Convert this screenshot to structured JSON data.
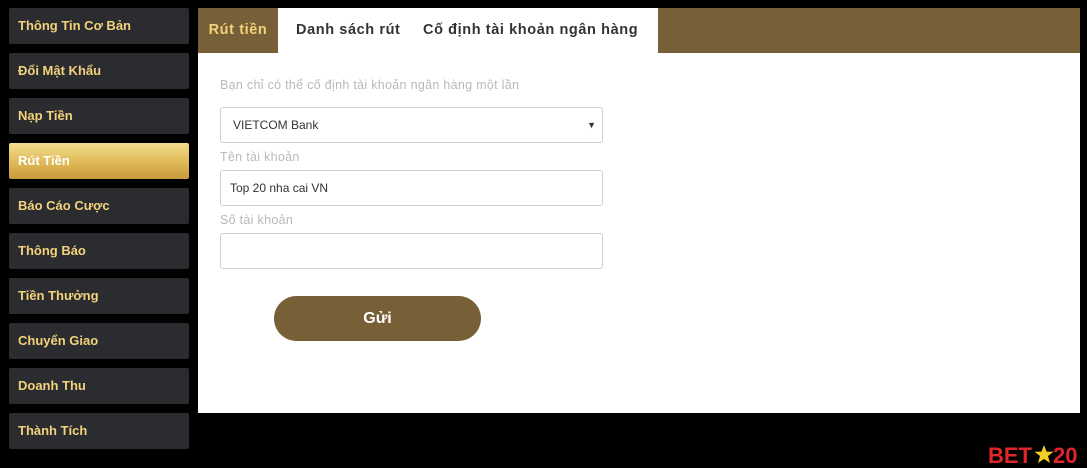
{
  "sidebar": {
    "items": [
      {
        "label": "Thông Tin Cơ Bản"
      },
      {
        "label": "Đổi Mật Khẩu"
      },
      {
        "label": "Nạp Tiền"
      },
      {
        "label": "Rút Tiền"
      },
      {
        "label": "Báo Cáo Cược"
      },
      {
        "label": "Thông Báo"
      },
      {
        "label": "Tiền Thưởng"
      },
      {
        "label": "Chuyển Giao"
      },
      {
        "label": "Doanh Thu"
      },
      {
        "label": "Thành Tích"
      }
    ],
    "active_index": 3,
    "active_color": "#e1bc5a",
    "text_color": "#f2d27a"
  },
  "tabs": {
    "items": [
      {
        "label": "Rút tiền"
      },
      {
        "label": "Danh sách rút"
      },
      {
        "label": "Cố định tài khoản ngân hàng"
      }
    ],
    "bar_color": "#776037"
  },
  "form": {
    "hint": "Bạn chỉ có thể cố định tài khoản ngân hàng một lần",
    "bank_select": {
      "value": "VIETCOM Bank"
    },
    "account_name": {
      "label": "Tên tài khoản",
      "value": "Top 20 nha cai VN"
    },
    "account_number": {
      "label": "Số tài khoản",
      "value": ""
    },
    "submit_label": "Gửi"
  },
  "logo": {
    "text": "BET20"
  }
}
